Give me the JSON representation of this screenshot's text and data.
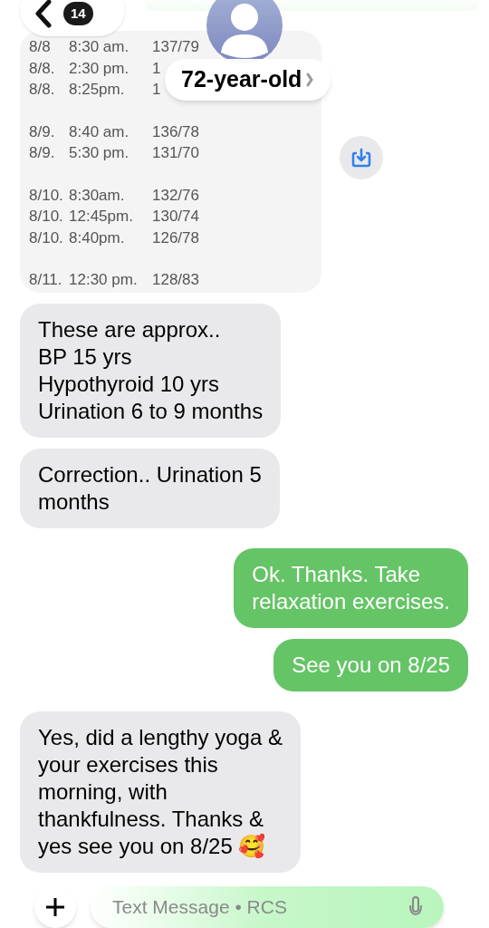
{
  "header": {
    "back_count": "14",
    "contact_name": "72-year-old"
  },
  "messages": [
    {
      "kind": "sent_cut"
    },
    {
      "kind": "image",
      "groups": [
        [
          {
            "date": "8/8",
            "time": "8:30 am.",
            "value": "137/79"
          },
          {
            "date": "8/8.",
            "time": "2:30 pm.",
            "value": "1"
          },
          {
            "date": "8/8.",
            "time": "8:25pm.",
            "value": "1"
          }
        ],
        [
          {
            "date": "8/9.",
            "time": "8:40 am.",
            "value": "136/78"
          },
          {
            "date": "8/9.",
            "time": "5:30 pm.",
            "value": "131/70"
          }
        ],
        [
          {
            "date": "8/10.",
            "time": "8:30am.",
            "value": "132/76"
          },
          {
            "date": "8/10.",
            "time": "12:45pm.",
            "value": "130/74"
          },
          {
            "date": "8/10.",
            "time": "8:40pm.",
            "value": "126/78"
          }
        ],
        [
          {
            "date": "8/11.",
            "time": "12:30 pm.",
            "value": "128/83"
          }
        ]
      ]
    },
    {
      "kind": "received",
      "lines": [
        "These are approx..",
        "BP 15 yrs",
        "Hypothyroid 10 yrs",
        "Urination 6 to 9 months"
      ]
    },
    {
      "kind": "received",
      "lines": [
        "Correction.. Urination 5",
        "months"
      ]
    },
    {
      "kind": "sent",
      "lines": [
        "Ok. Thanks. Take",
        "relaxation exercises."
      ]
    },
    {
      "kind": "sent",
      "lines": [
        "See you on 8/25"
      ]
    },
    {
      "kind": "received",
      "lines": [
        "Yes, did a lengthy yoga &",
        "your exercises this",
        "morning, with",
        "thankfulness. Thanks &",
        "yes see you on 8/25 🥰"
      ]
    }
  ],
  "composer": {
    "placeholder": "Text Message • RCS"
  }
}
